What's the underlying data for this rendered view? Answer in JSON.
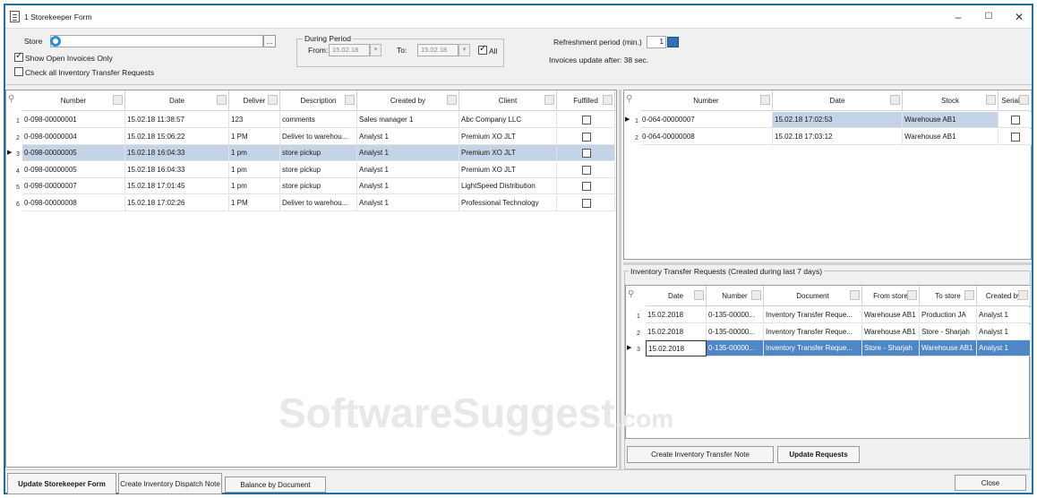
{
  "window": {
    "title": "1 Storekeeper Form",
    "minimize": "–",
    "maximize": "☐",
    "close": "✕"
  },
  "filters": {
    "store_label": "Store",
    "show_open_label": "Show Open Invoices Only",
    "show_open_checked": true,
    "check_all_label": "Check all Inventory Transfer Requests",
    "check_all_checked": false,
    "browse_label": "...",
    "period_group": "During Period",
    "from_label": "From:",
    "from_value": "15.02.18",
    "to_label": "To:",
    "to_value": "15.02.18",
    "all_label": "All",
    "all_checked": true,
    "refresh_label": "Refreshment period (min.)",
    "refresh_value": "1",
    "update_after": "Invoices update after: 38 sec."
  },
  "invoices": {
    "columns": [
      "Number",
      "Date",
      "Deliver",
      "Description",
      "Created by",
      "Client",
      "Fulfilled"
    ],
    "selected_row": 3,
    "rows": [
      {
        "rn": "1",
        "number": "0-098-00000001",
        "date": "15.02.18 11:38:57",
        "deliver": "123",
        "description": "comments",
        "created_by": "Sales manager 1",
        "client": "Abc Company LLC"
      },
      {
        "rn": "2",
        "number": "0-098-00000004",
        "date": "15.02.18 15:06:22",
        "deliver": "1 PM",
        "description": "Deliver to warehou...",
        "created_by": "Analyst 1",
        "client": "Premium XO JLT"
      },
      {
        "rn": "3",
        "number": "0-098-00000005",
        "date": "15.02.18 16:04:33",
        "deliver": "1 pm",
        "description": "store pickup",
        "created_by": "Analyst 1",
        "client": "Premium XO JLT"
      },
      {
        "rn": "4",
        "number": "0-098-00000005",
        "date": "15.02.18 16:04:33",
        "deliver": "1 pm",
        "description": "store pickup",
        "created_by": "Analyst 1",
        "client": "Premium XO JLT"
      },
      {
        "rn": "5",
        "number": "0-098-00000007",
        "date": "15.02.18 17:01:45",
        "deliver": "1 pm",
        "description": "store pickup",
        "created_by": "Analyst 1",
        "client": "LightSpeed Distribution"
      },
      {
        "rn": "6",
        "number": "0-098-00000008",
        "date": "15.02.18 17:02:26",
        "deliver": "1 PM",
        "description": "Deliver to warehou...",
        "created_by": "Analyst 1",
        "client": "Professional Technology"
      }
    ]
  },
  "stock": {
    "columns": [
      "Number",
      "Date",
      "Stock",
      "Serial ..."
    ],
    "rows": [
      {
        "rn": "1",
        "number": "0-064-00000007",
        "date": "15.02.18 17:02:53",
        "stock": "Warehouse AB1"
      },
      {
        "rn": "2",
        "number": "0-064-00000008",
        "date": "15.02.18 17:03:12",
        "stock": "Warehouse AB1"
      }
    ]
  },
  "transfers": {
    "group_title": "Inventory Transfer Requests (Created during last 7 days)",
    "columns": [
      "Date",
      "Number",
      "Document",
      "From store",
      "To store",
      "Created by"
    ],
    "rows": [
      {
        "rn": "1",
        "date": "15.02.2018",
        "number": "0-135-00000...",
        "document": "Inventory Transfer Reque...",
        "from": "Warehouse AB1",
        "to": "Production JA",
        "created_by": "Analyst 1"
      },
      {
        "rn": "2",
        "date": "15.02.2018",
        "number": "0-135-00000...",
        "document": "Inventory Transfer Reque...",
        "from": "Warehouse AB1",
        "to": "Store - Sharjah",
        "created_by": "Analyst 1"
      },
      {
        "rn": "3",
        "date": "15.02.2018",
        "number": "0-135-00000...",
        "document": "Inventory Transfer Reque...",
        "from": "Store - Sharjah",
        "to": "Warehouse AB1",
        "created_by": "Analyst 1"
      }
    ],
    "create_btn": "Create Inventory Transfer Note",
    "update_btn": "Update Requests"
  },
  "footer": {
    "update_btn": "Update Storekeeper Form",
    "dispatch_btn": "Create Inventory Dispatch Note",
    "balance_btn": "Balance by Document",
    "close_btn": "Close"
  },
  "watermark": {
    "main": "SoftwareSuggest",
    "suffix": ".com"
  },
  "colors": {
    "selection": "#c5d3e6",
    "selection_blue": "#4f86c6",
    "window_border": "#1f6f9e"
  }
}
